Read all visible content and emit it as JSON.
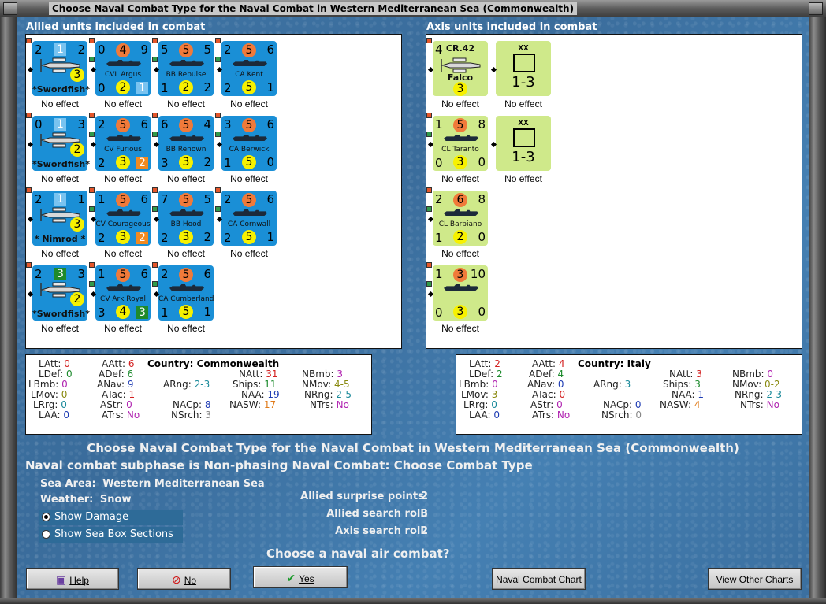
{
  "window": {
    "title": "Choose Naval Combat Type for the Naval Combat in Western Mediterranean Sea (Commonwealth)"
  },
  "allied": {
    "header": "Allied units included in combat",
    "units": [
      {
        "kind": "plane",
        "tl": "2",
        "tm": "1",
        "tr": "2",
        "center": "3",
        "name": "*Swordfish*",
        "effect": "No effect"
      },
      {
        "kind": "ship",
        "tl": "0",
        "tm": "4",
        "tr": "9",
        "name": "CVL Argus",
        "bl": "0",
        "bm": "2",
        "br": "1",
        "effect": "No effect"
      },
      {
        "kind": "ship",
        "tl": "5",
        "tm": "5",
        "tr": "5",
        "name": "BB Repulse",
        "bl": "1",
        "bm": "2",
        "br": "2",
        "effect": "No effect"
      },
      {
        "kind": "ship",
        "tl": "2",
        "tm": "5",
        "tr": "6",
        "name": "CA Kent",
        "bl": "2",
        "bm": "5",
        "br": "1",
        "effect": "No effect"
      },
      {
        "kind": "plane",
        "tl": "0",
        "tm": "1",
        "tr": "3",
        "center": "2",
        "name": "*Swordfish*",
        "effect": "No effect"
      },
      {
        "kind": "ship",
        "tl": "2",
        "tm": "5",
        "tr": "6",
        "name": "CV Furious",
        "bl": "2",
        "bm": "3",
        "br": "2",
        "effect": "No effect"
      },
      {
        "kind": "ship",
        "tl": "6",
        "tm": "5",
        "tr": "4",
        "name": "BB Renown",
        "bl": "3",
        "bm": "3",
        "br": "2",
        "effect": "No effect"
      },
      {
        "kind": "ship",
        "tl": "3",
        "tm": "5",
        "tr": "6",
        "name": "CA Berwick",
        "bl": "1",
        "bm": "5",
        "br": "0",
        "effect": "No effect"
      },
      {
        "kind": "plane",
        "tl": "2",
        "tm": "1",
        "tr": "1",
        "center": "3",
        "name": "* Nimrod *",
        "effect": "No effect"
      },
      {
        "kind": "ship",
        "tl": "1",
        "tm": "5",
        "tr": "6",
        "name": "CV Courageous",
        "bl": "2",
        "bm": "3",
        "br": "2",
        "effect": "No effect"
      },
      {
        "kind": "ship",
        "tl": "7",
        "tm": "5",
        "tr": "5",
        "name": "BB Hood",
        "bl": "2",
        "bm": "3",
        "br": "2",
        "effect": "No effect"
      },
      {
        "kind": "ship",
        "tl": "2",
        "tm": "5",
        "tr": "6",
        "name": "CA Cornwall",
        "bl": "2",
        "bm": "5",
        "br": "1",
        "effect": "No effect"
      },
      {
        "kind": "plane",
        "tl": "2",
        "tm": "3",
        "tr": "3",
        "center": "2",
        "name": "*Swordfish*",
        "effect": "No effect"
      },
      {
        "kind": "ship",
        "tl": "1",
        "tm": "5",
        "tr": "6",
        "name": "CV Ark Royal",
        "bl": "3",
        "bm": "4",
        "br": "3",
        "effect": "No effect"
      },
      {
        "kind": "ship",
        "tl": "2",
        "tm": "5",
        "tr": "6",
        "name": "CA Cumberland",
        "bl": "1",
        "bm": "5",
        "br": "1",
        "effect": "No effect"
      }
    ]
  },
  "axis": {
    "header": "Axis units included in combat",
    "units": [
      {
        "kind": "plane",
        "tl": "4",
        "title": "CR.42",
        "name": "Falco",
        "center": "3",
        "effect": "No effect"
      },
      {
        "kind": "land",
        "xx": "XX",
        "value": "1-3",
        "effect": "No effect"
      },
      {
        "kind": "ship",
        "tl": "1",
        "tm": "5",
        "tr": "8",
        "name": "CL Taranto",
        "bl": "0",
        "bm": "3",
        "br": "0",
        "effect": "No effect"
      },
      {
        "kind": "land",
        "xx": "XX",
        "value": "1-3",
        "effect": "No effect"
      },
      {
        "kind": "ship",
        "tl": "2",
        "tm": "6",
        "tr": "8",
        "name": "CL Barbiano",
        "bl": "1",
        "bm": "2",
        "br": "0",
        "effect": "No effect"
      },
      {
        "kind": "ship",
        "tl": "1",
        "tm": "3",
        "tr": "10",
        "name": "",
        "bl": "0",
        "bm": "3",
        "br": "0",
        "effect": "No effect"
      }
    ]
  },
  "allied_stats": {
    "LAtt": "0",
    "LDef": "0",
    "LBmb": "0",
    "LMov": "0",
    "LRrg": "0",
    "LAA": "0",
    "AAtt": "6",
    "ADef": "6",
    "ANav": "9",
    "ATac": "1",
    "AStr": "0",
    "ATrs": "No",
    "country": "Country: Commonwealth",
    "ARng": "2-3",
    "NACp": "8",
    "NSrch": "3",
    "NAtt": "31",
    "Ships": "11",
    "NAA": "19",
    "NASW": "17",
    "NBmb": "3",
    "NMov": "4-5",
    "NRng": "2-5",
    "NTrs": "No"
  },
  "axis_stats": {
    "LAtt": "2",
    "LDef": "2",
    "LBmb": "0",
    "LMov": "3",
    "LRrg": "0",
    "LAA": "0",
    "AAtt": "4",
    "ADef": "4",
    "ANav": "0",
    "ATac": "0",
    "AStr": "0",
    "ATrs": "No",
    "country": "Country: Italy",
    "ARng": "3",
    "NACp": "0",
    "NSrch": "0",
    "NAtt": "3",
    "Ships": "3",
    "NAA": "1",
    "NASW": "4",
    "NBmb": "0",
    "NMov": "0-2",
    "NRng": "2-3",
    "NTrs": "No"
  },
  "info": {
    "heading": "Choose Naval Combat Type for the Naval Combat in Western Mediterranean Sea (Commonwealth)",
    "subphase": "Naval combat subphase is Non-phasing Naval Combat: Choose Combat Type",
    "sea_area_label": "Sea Area:",
    "sea_area": "Western Mediterranean Sea",
    "weather_label": "Weather:",
    "weather": "Snow",
    "show_damage": "Show Damage",
    "show_sea_box": "Show Sea Box Sections",
    "surprise_label": "Allied surprise points:",
    "surprise": "2",
    "allied_search_label": "Allied search roll:",
    "allied_search": "3",
    "axis_search_label": "Axis search roll:",
    "axis_search": "2",
    "question": "Choose a naval air combat?"
  },
  "buttons": {
    "help": "Help",
    "no": "No",
    "yes": "Yes",
    "naval_chart": "Naval Combat Chart",
    "other_charts": "View Other Charts"
  }
}
